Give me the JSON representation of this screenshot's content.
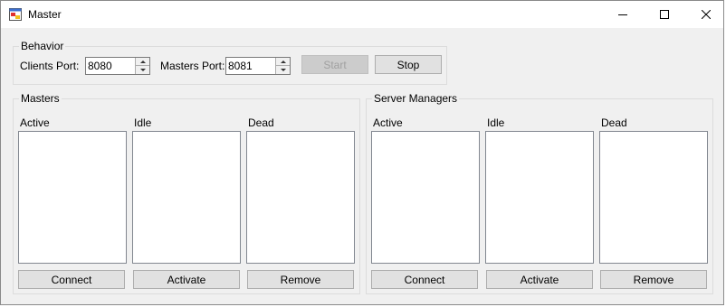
{
  "window": {
    "title": "Master"
  },
  "behavior": {
    "legend": "Behavior",
    "clients_port_label": "Clients Port:",
    "clients_port_value": "8080",
    "masters_port_label": "Masters Port:",
    "masters_port_value": "8081",
    "start_label": "Start",
    "stop_label": "Stop"
  },
  "masters": {
    "legend": "Masters",
    "active_label": "Active",
    "idle_label": "Idle",
    "dead_label": "Dead",
    "connect_label": "Connect",
    "activate_label": "Activate",
    "remove_label": "Remove"
  },
  "server_managers": {
    "legend": "Server Managers",
    "active_label": "Active",
    "idle_label": "Idle",
    "dead_label": "Dead",
    "connect_label": "Connect",
    "activate_label": "Activate",
    "remove_label": "Remove"
  }
}
